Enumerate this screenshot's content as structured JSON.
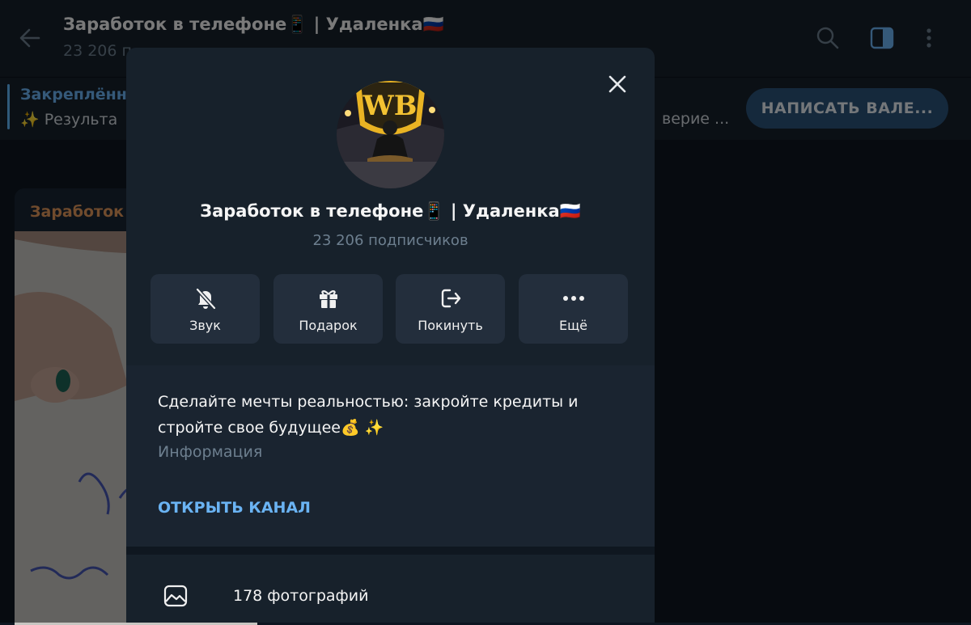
{
  "header": {
    "title": "Заработок в телефоне📱 | Удаленка🇷🇺",
    "subtitle": "23 206 п",
    "icons": [
      "back-arrow-icon",
      "search-icon",
      "sidebar-toggle-icon",
      "more-vertical-icon"
    ]
  },
  "pinned": {
    "title": "Закреплённ",
    "text": "✨ Результа",
    "text_tail": "верие ...",
    "button_label": "НАПИСАТЬ ВАЛЕ..."
  },
  "post": {
    "author": "Заработок"
  },
  "profile": {
    "name": "Заработок в телефоне📱 | Удаленка🇷🇺",
    "subscribers": "23 206 подписчиков",
    "actions": [
      {
        "label": "Звук",
        "icon": "bell-off-icon"
      },
      {
        "label": "Подарок",
        "icon": "gift-icon"
      },
      {
        "label": "Покинуть",
        "icon": "leave-icon"
      },
      {
        "label": "Ещё",
        "icon": "more-dots-icon"
      }
    ],
    "description": "Сделайте мечты реальностью: закройте кредиты и стройте свое будущее💰 ✨",
    "description_label": "Информация",
    "open_channel": "ОТКРЫТЬ КАНАЛ",
    "media": {
      "label": "178 фотографий",
      "icon": "photo-icon"
    }
  },
  "colors": {
    "background": "#0e1621",
    "panel": "#17212b",
    "button": "#232e3c",
    "accent": "#6ab3f3",
    "muted": "#6d7f8f"
  }
}
